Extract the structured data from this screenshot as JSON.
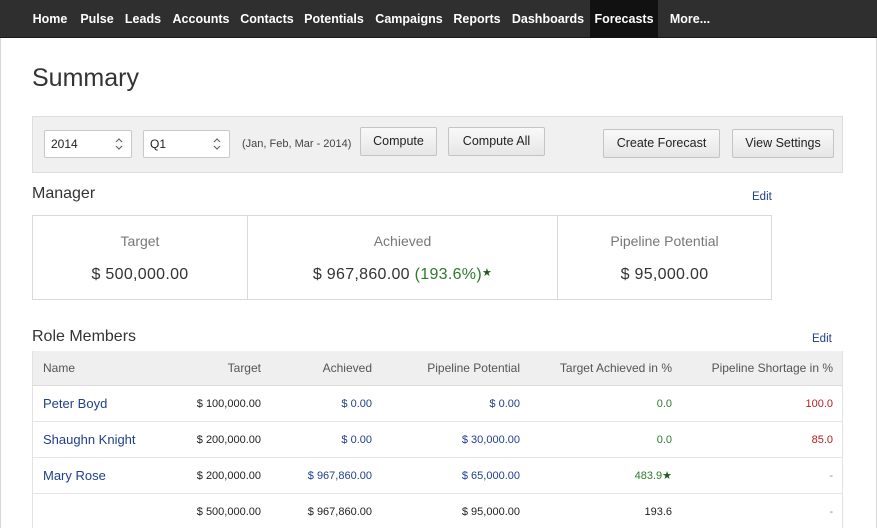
{
  "nav": {
    "items": [
      "Home",
      "Pulse",
      "Leads",
      "Accounts",
      "Contacts",
      "Potentials",
      "Campaigns",
      "Reports",
      "Dashboards",
      "Forecasts",
      "More..."
    ],
    "active": "Forecasts"
  },
  "page": {
    "title": "Summary"
  },
  "toolbar": {
    "year_value": "2014",
    "quarter_value": "Q1",
    "period_label": "(Jan, Feb, Mar - 2014)",
    "compute_label": "Compute",
    "compute_all_label": "Compute All",
    "create_forecast_label": "Create Forecast",
    "view_settings_label": "View Settings"
  },
  "manager": {
    "title": "Manager",
    "edit_label": "Edit",
    "target_label": "Target",
    "target_value": "$ 500,000.00",
    "achieved_label": "Achieved",
    "achieved_value": "$ 967,860.00",
    "achieved_percent": "(193.6%)",
    "achieved_marker": "★",
    "pipeline_label": "Pipeline Potential",
    "pipeline_value": "$ 95,000.00"
  },
  "role_members": {
    "title": "Role Members",
    "edit_label": "Edit",
    "columns": [
      "Name",
      "Target",
      "Achieved",
      "Pipeline Potential",
      "Target Achieved in %",
      "Pipeline Shortage in %"
    ],
    "rows": [
      {
        "name": "Peter Boyd",
        "target": "$ 100,000.00",
        "achieved": "$ 0.00",
        "pipeline": "$ 0.00",
        "target_pct": "0.0",
        "target_pct_marker": "",
        "shortage_pct": "100.0"
      },
      {
        "name": "Shaughn Knight",
        "target": "$ 200,000.00",
        "achieved": "$ 0.00",
        "pipeline": "$ 30,000.00",
        "target_pct": "0.0",
        "target_pct_marker": "",
        "shortage_pct": "85.0"
      },
      {
        "name": "Mary Rose",
        "target": "$ 200,000.00",
        "achieved": "$ 967,860.00",
        "pipeline": "$ 65,000.00",
        "target_pct": "483.9",
        "target_pct_marker": "★",
        "shortage_pct": "-"
      }
    ],
    "totals": {
      "target": "$ 500,000.00",
      "achieved": "$ 967,860.00",
      "pipeline": "$ 95,000.00",
      "target_pct": "193.6",
      "shortage_pct": "-"
    }
  },
  "colors": {
    "nav_bg": "#2f2f2f",
    "link": "#1f3f8c",
    "positive": "#2c7a2c",
    "negative": "#b21f1f"
  }
}
